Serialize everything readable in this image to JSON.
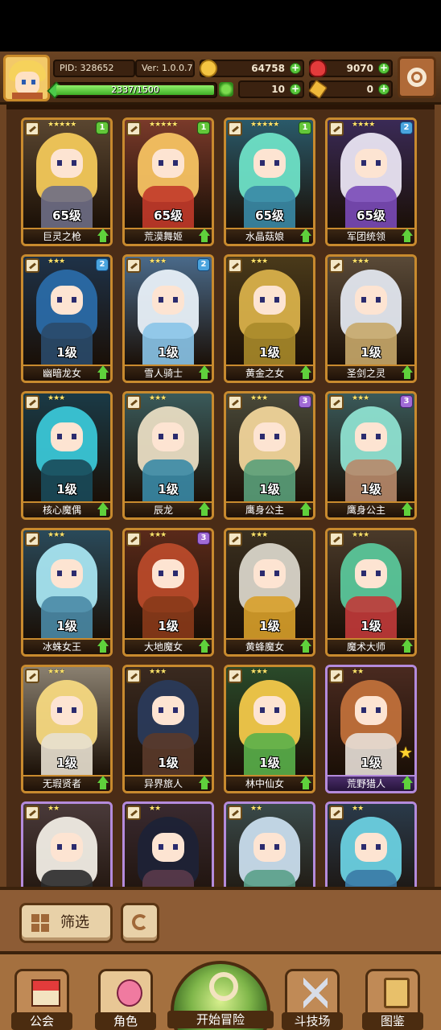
{
  "player": {
    "pid": "PID: 328652",
    "version": "Ver: 1.0.0.7",
    "xp_text": "2337/1500",
    "xp_fraction": 1.0
  },
  "resources": {
    "gold": "64758",
    "gems": "9070",
    "clovers": "10",
    "keys": "0"
  },
  "heroes": [
    {
      "name": "巨灵之枪",
      "level": "65级",
      "stars": "★★★★★",
      "badge": "1",
      "badge_color": "green",
      "hair": "#f2c85a",
      "body": "#6e6e86",
      "bg": "#5a4630",
      "rare": false,
      "fav": false
    },
    {
      "name": "荒漠舞姬",
      "level": "65级",
      "stars": "★★★★★",
      "badge": "1",
      "badge_color": "green",
      "hair": "#f6c262",
      "body": "#c23a2a",
      "bg": "#7a3a2a",
      "rare": false,
      "fav": false
    },
    {
      "name": "水晶菇娘",
      "level": "65级",
      "stars": "★★★★★",
      "badge": "1",
      "badge_color": "green",
      "hair": "#6ee0c6",
      "body": "#3a8aa6",
      "bg": "#2a5a6a",
      "rare": false,
      "fav": false
    },
    {
      "name": "军团统领",
      "level": "65级",
      "stars": "★★★★",
      "badge": "2",
      "badge_color": "blue",
      "hair": "#e9e4f2",
      "body": "#7a4ab8",
      "bg": "#3a2a56",
      "rare": false,
      "fav": false
    },
    {
      "name": "幽暗龙女",
      "level": "1级",
      "stars": "★★★",
      "badge": "2",
      "badge_color": "blue",
      "hair": "#2a6aa6",
      "body": "#2a4a6a",
      "bg": "#1e3248",
      "rare": false,
      "fav": false
    },
    {
      "name": "雪人骑士",
      "level": "1级",
      "stars": "★★★",
      "badge": "2",
      "badge_color": "blue",
      "hair": "#e8f0f8",
      "body": "#8ac4e8",
      "bg": "#4a6a8a",
      "rare": false,
      "fav": false
    },
    {
      "name": "黄金之女",
      "level": "1级",
      "stars": "★★★",
      "badge": "",
      "badge_color": "",
      "hair": "#d8b04a",
      "body": "#a88a2a",
      "bg": "#4a3a1a",
      "rare": false,
      "fav": false
    },
    {
      "name": "圣剑之灵",
      "level": "1级",
      "stars": "★★★",
      "badge": "",
      "badge_color": "",
      "hair": "#e2e6ee",
      "body": "#c8a86a",
      "bg": "#5a4a38",
      "rare": false,
      "fav": false
    },
    {
      "name": "核心魔偶",
      "level": "1级",
      "stars": "★★★",
      "badge": "",
      "badge_color": "",
      "hair": "#3ac6d6",
      "body": "#1a4a5a",
      "bg": "#1a3a46",
      "rare": false,
      "fav": false
    },
    {
      "name": "辰龙",
      "level": "1级",
      "stars": "★★★",
      "badge": "",
      "badge_color": "",
      "hair": "#e8dcc2",
      "body": "#3a8aa6",
      "bg": "#3a5a5a",
      "rare": false,
      "fav": false
    },
    {
      "name": "鹰身公主",
      "level": "1级",
      "stars": "★★★",
      "badge": "3",
      "badge_color": "purple",
      "hair": "#f0d49a",
      "body": "#5aa07a",
      "bg": "#4a4a3a",
      "rare": false,
      "fav": false
    },
    {
      "name": "鹰身公主",
      "level": "1级",
      "stars": "★★★",
      "badge": "3",
      "badge_color": "purple",
      "hair": "#8ee0d0",
      "body": "#b88a6a",
      "bg": "#3a5a5a",
      "rare": false,
      "fav": false
    },
    {
      "name": "冰蛛女王",
      "level": "1级",
      "stars": "★★★",
      "badge": "",
      "badge_color": "",
      "hair": "#a6e4f0",
      "body": "#4a8aa6",
      "bg": "#2a4a5a",
      "rare": false,
      "fav": false
    },
    {
      "name": "大地魔女",
      "level": "1级",
      "stars": "★★★",
      "badge": "3",
      "badge_color": "purple",
      "hair": "#b84a2a",
      "body": "#8a3a1a",
      "bg": "#5a2a1a",
      "rare": false,
      "fav": false
    },
    {
      "name": "黄蜂魔女",
      "level": "1级",
      "stars": "★★★",
      "badge": "",
      "badge_color": "",
      "hair": "#d8d4c8",
      "body": "#d8a02a",
      "bg": "#3a3020",
      "rare": false,
      "fav": false
    },
    {
      "name": "魔术大师",
      "level": "1级",
      "stars": "★★★",
      "badge": "",
      "badge_color": "",
      "hair": "#5ac69a",
      "body": "#c23a3a",
      "bg": "#4a3a2a",
      "rare": false,
      "fav": false
    },
    {
      "name": "无瑕贤者",
      "level": "1级",
      "stars": "★★★",
      "badge": "",
      "badge_color": "",
      "hair": "#f6d880",
      "body": "#e8e0d0",
      "bg": "#8a8070",
      "rare": false,
      "fav": false
    },
    {
      "name": "异界旅人",
      "level": "1级",
      "stars": "★★★",
      "badge": "",
      "badge_color": "",
      "hair": "#2a3a5a",
      "body": "#5a3a2a",
      "bg": "#3a2a20",
      "rare": false,
      "fav": false
    },
    {
      "name": "林中仙女",
      "level": "1级",
      "stars": "★★★",
      "badge": "",
      "badge_color": "",
      "hair": "#f2c84a",
      "body": "#5ab04a",
      "bg": "#2a4a2a",
      "rare": false,
      "fav": false
    },
    {
      "name": "荒野猎人",
      "level": "1级",
      "stars": "★★",
      "badge": "",
      "badge_color": "",
      "hair": "#c0703a",
      "body": "#e8e0d8",
      "bg": "#4a2a20",
      "rare": true,
      "fav": true
    },
    {
      "name": "",
      "level": "",
      "stars": "★★",
      "badge": "",
      "badge_color": "",
      "hair": "#f0ece4",
      "body": "#2a2a2a",
      "bg": "#4a3a3a",
      "rare": true,
      "fav": false
    },
    {
      "name": "",
      "level": "",
      "stars": "★★",
      "badge": "",
      "badge_color": "",
      "hair": "#1e2236",
      "body": "#5a3a4a",
      "bg": "#3a2a30",
      "rare": true,
      "fav": false
    },
    {
      "name": "",
      "level": "",
      "stars": "★★",
      "badge": "",
      "badge_color": "",
      "hair": "#c8dcec",
      "body": "#5aa08a",
      "bg": "#3a4a4a",
      "rare": true,
      "fav": false
    },
    {
      "name": "",
      "level": "",
      "stars": "★★",
      "badge": "",
      "badge_color": "",
      "hair": "#6ad0e0",
      "body": "#3a7aa6",
      "bg": "#2a3a4a",
      "rare": true,
      "fav": false
    }
  ],
  "filter": {
    "label": "筛选"
  },
  "nav": {
    "guild": "公会",
    "heroes": "角色",
    "adventure": "开始冒险",
    "arena": "斗技场",
    "codex": "图鉴"
  },
  "icons": {
    "gold": "coin-icon",
    "gems": "ruby-icon",
    "clovers": "clover-icon",
    "keys": "key-icon",
    "settings": "gear-icon"
  }
}
